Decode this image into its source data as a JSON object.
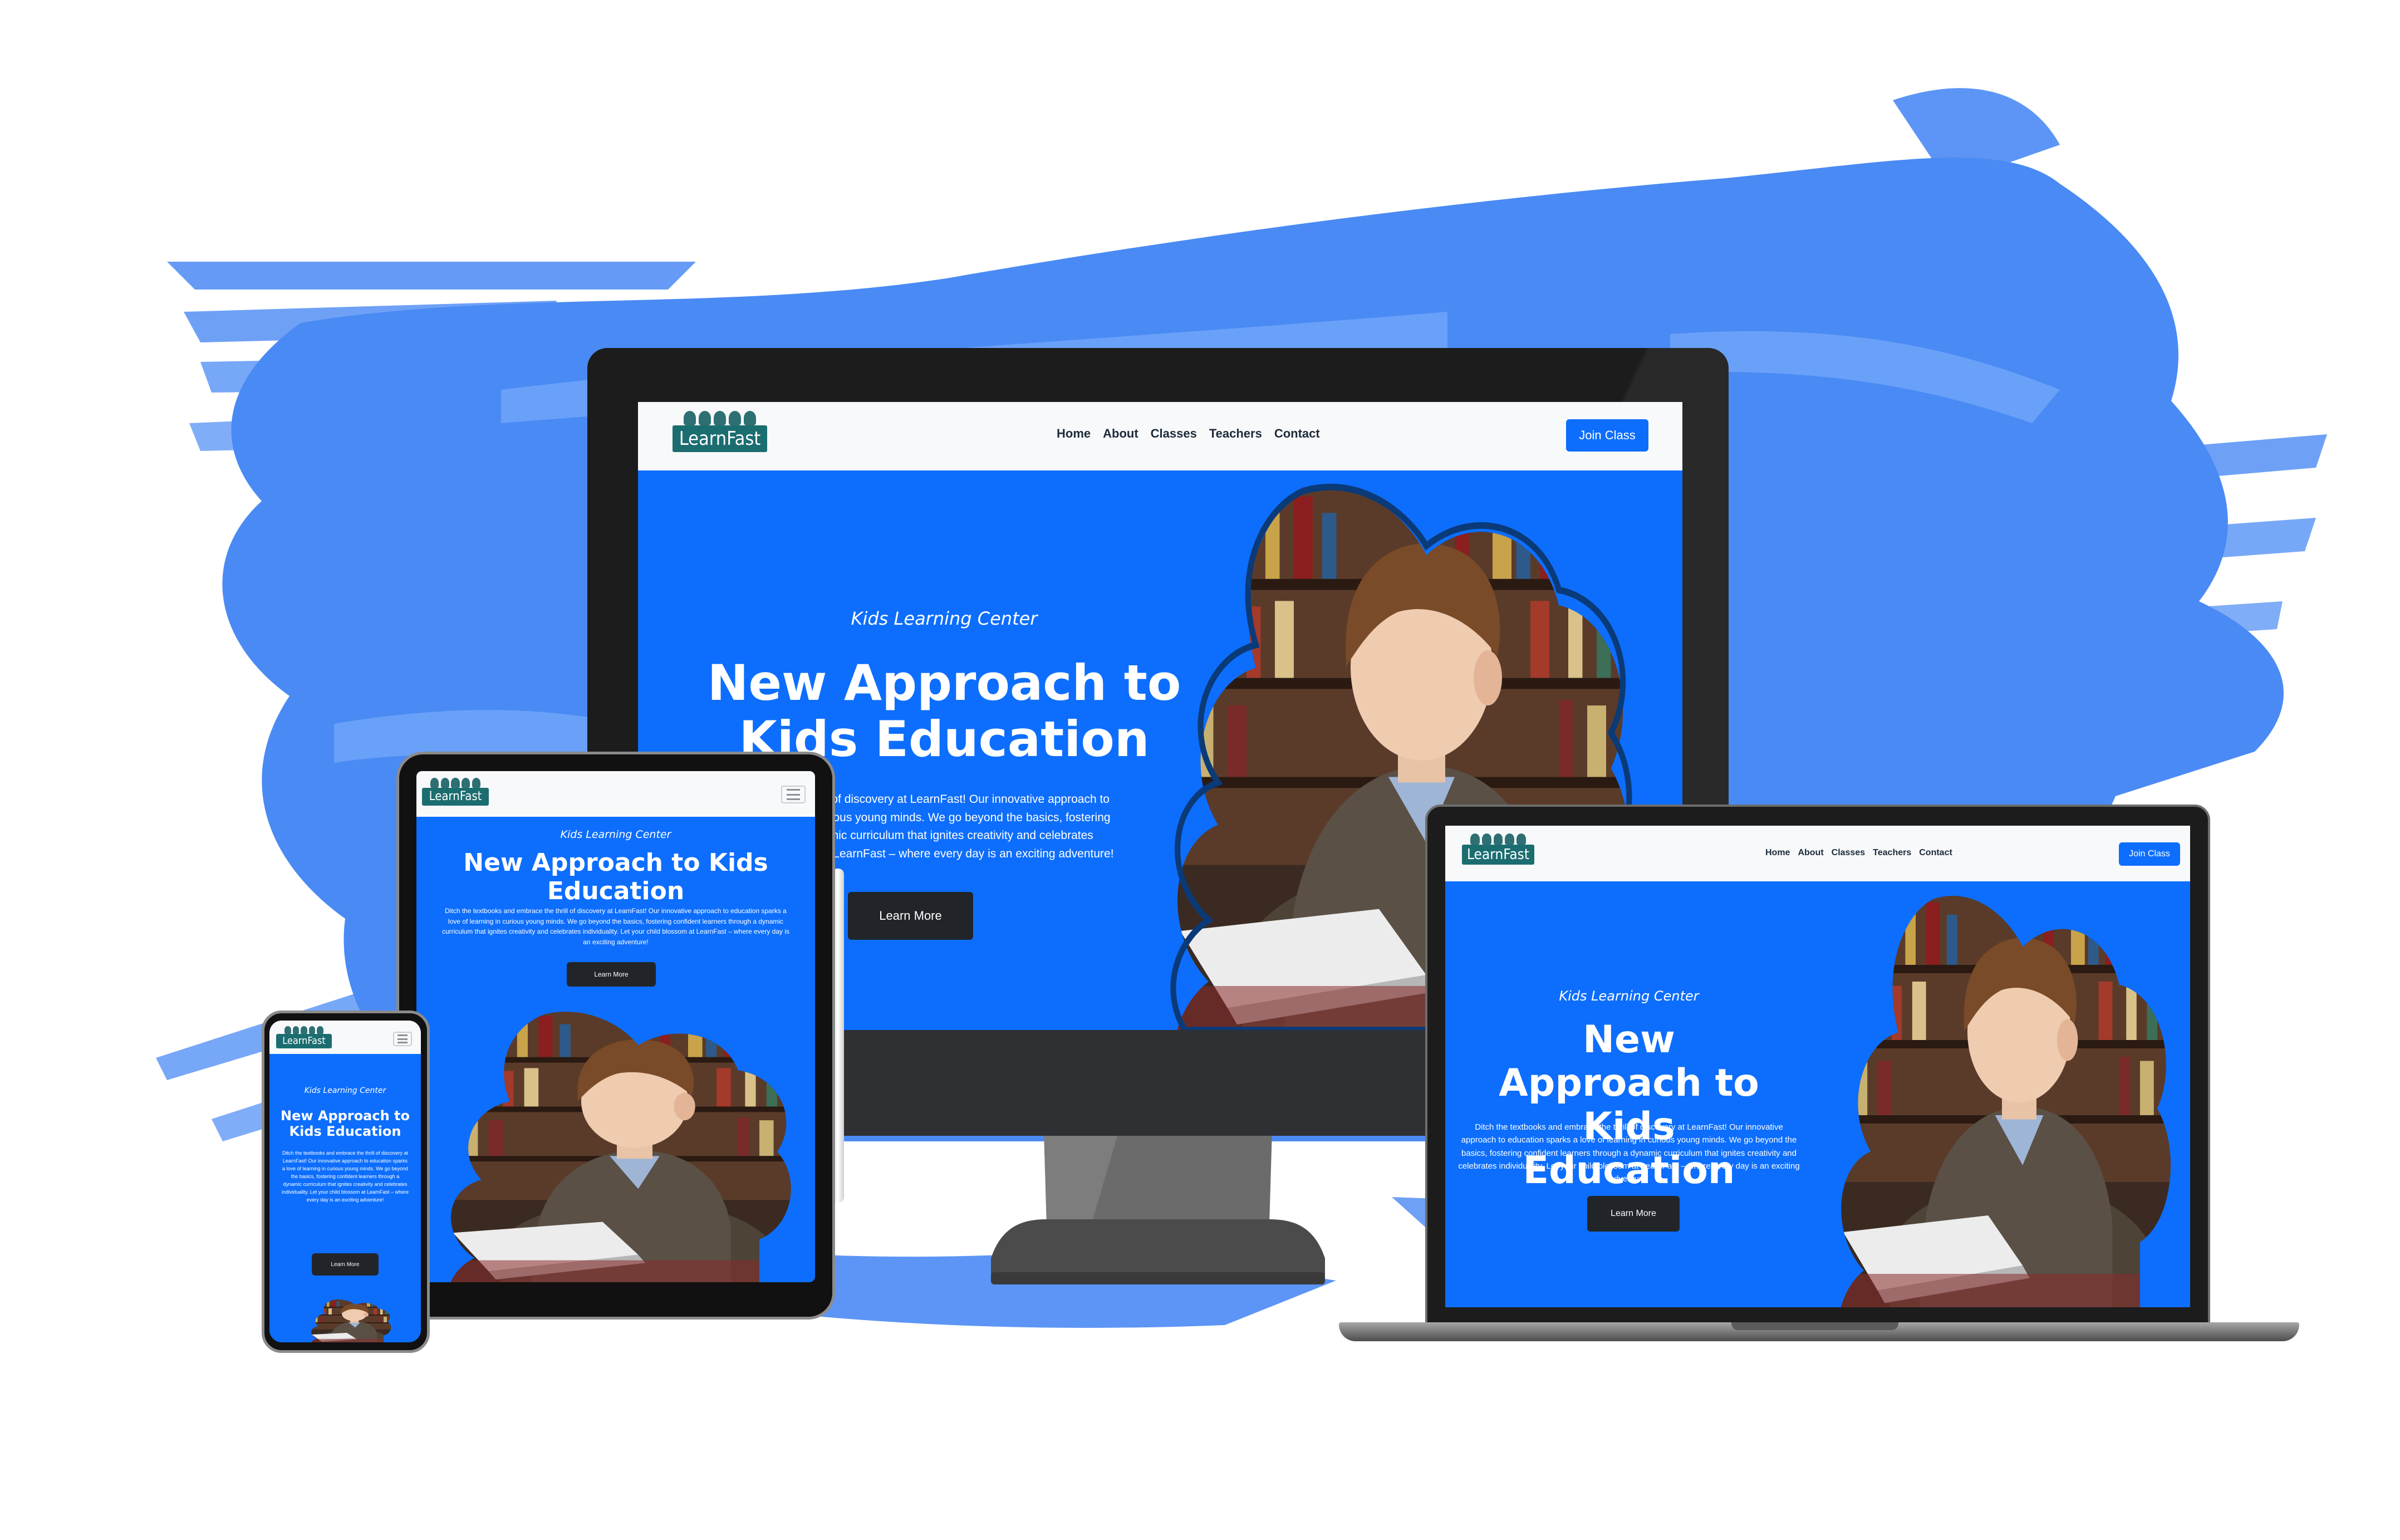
{
  "brand": {
    "logo_text": "LearnFast",
    "accent": "#0d6efd",
    "logo_color": "#1b6d70",
    "splash": "#4a8af4"
  },
  "nav": {
    "items": [
      "Home",
      "About",
      "Classes",
      "Teachers",
      "Contact"
    ],
    "cta": "Join Class"
  },
  "hero": {
    "eyebrow": "Kids Learning Center",
    "title": "New Approach to Kids Education",
    "body": "Ditch the textbooks and embrace the thrill of discovery at LearnFast! Our innovative approach to education sparks a love of learning in curious young minds. We go beyond the basics, fostering confident learners through a dynamic curriculum that ignites creativity and celebrates individuality. Let your child blossom at LearnFast – where every day is an exciting adventure!",
    "button": "Learn More",
    "image_icon": "boy-reading-book-photo"
  },
  "desktop_partial": {
    "body": "...e the thrill of discovery at LearnFast! Our innovative approach to ...ning in curious young minds. We go beyond the basics, fostering ...a dynamic curriculum that ignites creativity and celebrates ...blossom at LearnFast – where every day is an exciting adventure!"
  },
  "devices": [
    "desktop-monitor",
    "tablet",
    "phone",
    "laptop"
  ]
}
